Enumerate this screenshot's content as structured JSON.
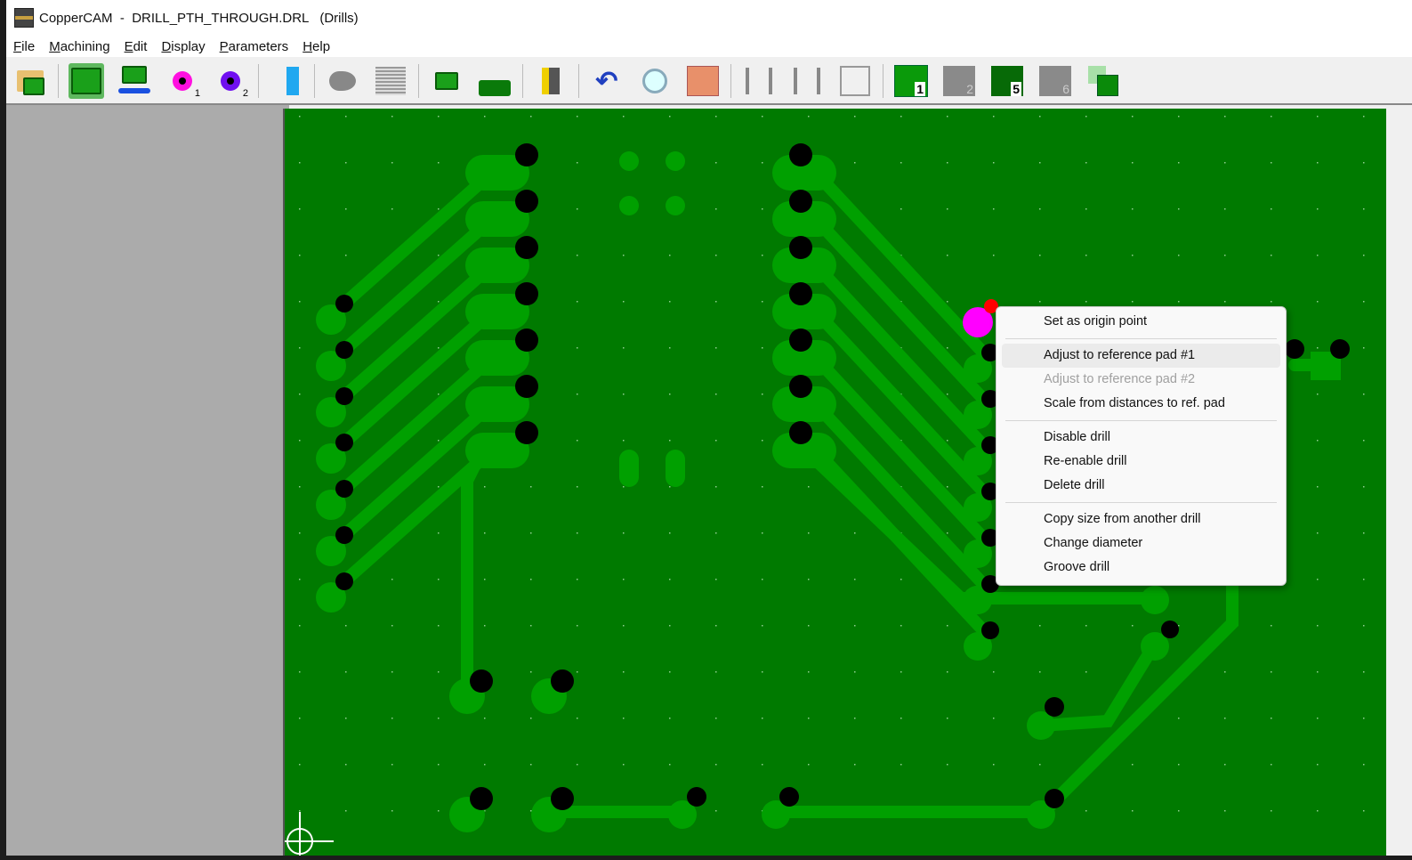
{
  "window": {
    "title": "CopperCAM  -  DRILL_PTH_THROUGH.DRL   (Drills)"
  },
  "menubar": [
    {
      "label": "File",
      "key": "F",
      "rest": "ile"
    },
    {
      "label": "Machining",
      "key": "M",
      "rest": "achining"
    },
    {
      "label": "Edit",
      "key": "E",
      "rest": "dit"
    },
    {
      "label": "Display",
      "key": "D",
      "rest": "isplay"
    },
    {
      "label": "Parameters",
      "key": "P",
      "rest": "arameters"
    },
    {
      "label": "Help",
      "key": "H",
      "rest": "elp"
    }
  ],
  "toolbar": {
    "icons": [
      "open-file-icon",
      "board-icon",
      "mirror-icon",
      "reference-pad-1-icon",
      "reference-pad-2-icon",
      "track-select-icon",
      "isolation-contour-icon",
      "hatching-icon",
      "drill-board-icon",
      "mill-board-icon",
      "engrave-icon",
      "undo-icon",
      "zoom-icon",
      "copper-layer-icon",
      "tracks-1-icon",
      "tracks-2-icon",
      "tracks-3-icon",
      "layer-1-icon",
      "layer-2-icon",
      "layer-5-drills-icon",
      "layer-6-icon",
      "panelize-icon"
    ],
    "layer_numbers": [
      "1",
      "2",
      "5",
      "6"
    ]
  },
  "colors": {
    "board": "#007a00",
    "copper": "#00a000",
    "drill": "#000000",
    "ref_pad": "#ff00ff",
    "accent": "#ff0000"
  },
  "context_menu": {
    "items": [
      {
        "label": "Set as origin point",
        "state": "enabled"
      },
      {
        "label": "Adjust to reference pad #1",
        "state": "highlighted"
      },
      {
        "label": "Adjust to reference pad #2",
        "state": "disabled"
      },
      {
        "label": "Scale from distances to ref. pad",
        "state": "enabled"
      },
      {
        "label": "Disable drill",
        "state": "enabled"
      },
      {
        "label": "Re-enable drill",
        "state": "enabled"
      },
      {
        "label": "Delete drill",
        "state": "enabled"
      },
      {
        "label": "Copy size from another drill",
        "state": "enabled"
      },
      {
        "label": "Change diameter",
        "state": "enabled"
      },
      {
        "label": "Groove drill",
        "state": "enabled"
      }
    ]
  }
}
